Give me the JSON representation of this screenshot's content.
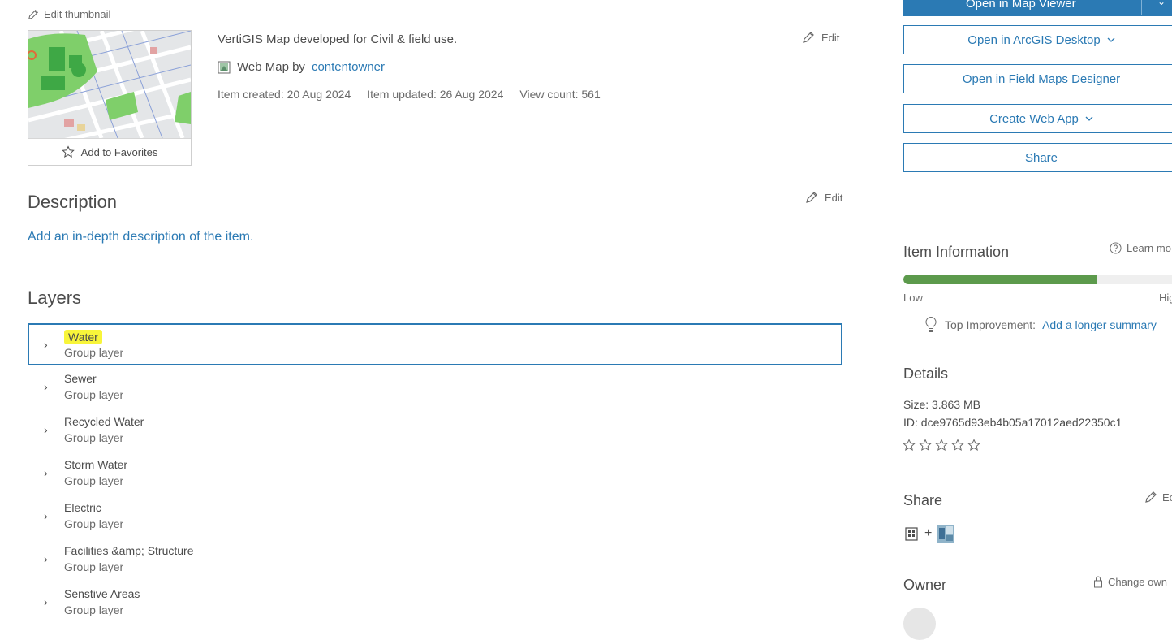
{
  "thumbnail": {
    "edit_label": "Edit thumbnail",
    "favorites_label": "Add to Favorites"
  },
  "summary": {
    "text": "VertiGIS Map developed for Civil & field use.",
    "edit_label": "Edit"
  },
  "item": {
    "type_text": "Web Map by",
    "owner_link": "contentowner",
    "created": "Item created: 20 Aug 2024",
    "updated": "Item updated: 26 Aug 2024",
    "views": "View count: 561"
  },
  "description": {
    "title": "Description",
    "edit_label": "Edit",
    "add_link": "Add an in-depth description of the item."
  },
  "layers": {
    "title": "Layers",
    "items": [
      {
        "name": "Water",
        "subtitle": "Group layer"
      },
      {
        "name": "Sewer",
        "subtitle": "Group layer"
      },
      {
        "name": "Recycled Water",
        "subtitle": "Group layer"
      },
      {
        "name": "Storm Water",
        "subtitle": "Group layer"
      },
      {
        "name": "Electric",
        "subtitle": "Group layer"
      },
      {
        "name": "Facilities &amp; Structure",
        "subtitle": "Group layer"
      },
      {
        "name": "Senstive Areas",
        "subtitle": "Group layer"
      }
    ]
  },
  "actions": {
    "map_viewer": "Open in Map Viewer",
    "arcgis_desktop": "Open in ArcGIS Desktop",
    "field_maps": "Open in Field Maps Designer",
    "web_app": "Create Web App",
    "share": "Share"
  },
  "item_info": {
    "title": "Item Information",
    "learn_more": "Learn mo",
    "low": "Low",
    "high": "Hig",
    "progress_fraction": 0.7,
    "top_improvement_label": "Top Improvement:",
    "top_improvement_link": "Add a longer summary"
  },
  "details": {
    "title": "Details",
    "size": "Size: 3.863 MB",
    "id": "ID: dce9765d93eb4b05a17012aed22350c1",
    "rating_stars": 0
  },
  "share": {
    "title": "Share",
    "edit_label": "Ec"
  },
  "owner": {
    "title": "Owner",
    "change_label": "Change own"
  },
  "colors": {
    "accent": "#2b7ab4",
    "progress": "#5c9a4c",
    "highlight": "#f8f53a"
  }
}
